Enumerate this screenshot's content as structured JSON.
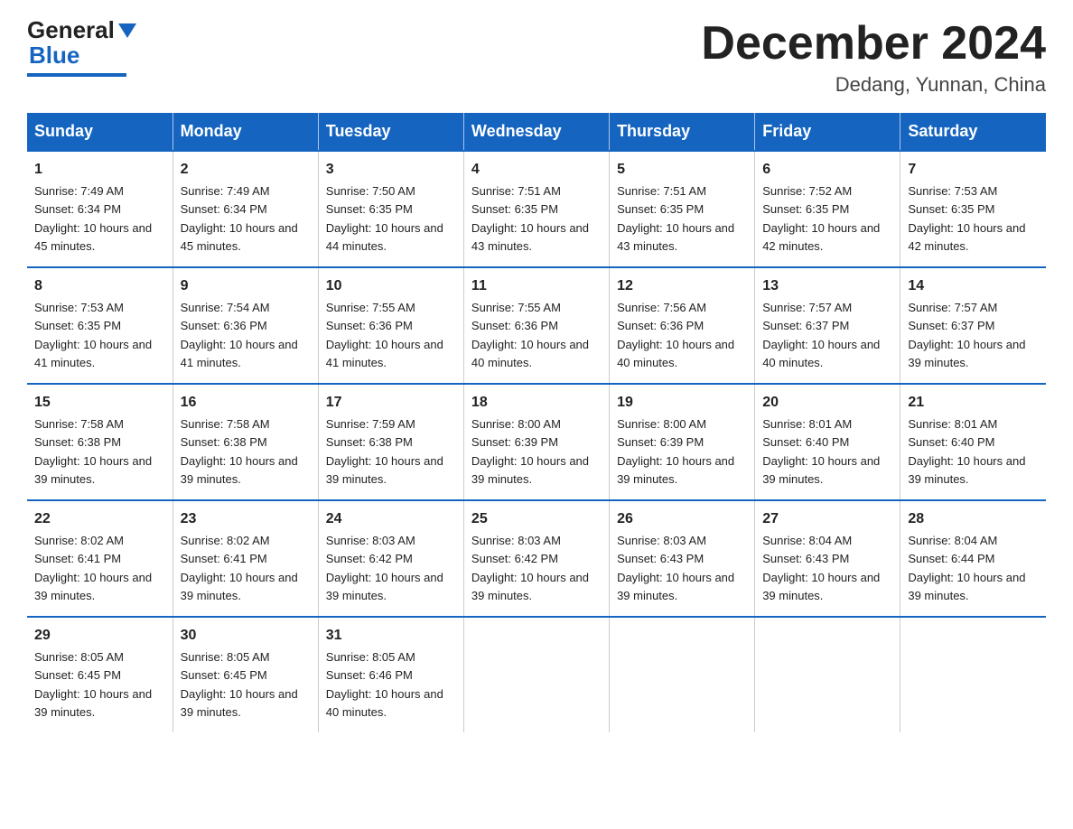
{
  "logo": {
    "general": "General",
    "triangle": "▶",
    "blue": "Blue"
  },
  "header": {
    "title": "December 2024",
    "subtitle": "Dedang, Yunnan, China"
  },
  "days_of_week": [
    "Sunday",
    "Monday",
    "Tuesday",
    "Wednesday",
    "Thursday",
    "Friday",
    "Saturday"
  ],
  "weeks": [
    [
      {
        "day": "1",
        "sunrise": "7:49 AM",
        "sunset": "6:34 PM",
        "daylight": "10 hours and 45 minutes."
      },
      {
        "day": "2",
        "sunrise": "7:49 AM",
        "sunset": "6:34 PM",
        "daylight": "10 hours and 45 minutes."
      },
      {
        "day": "3",
        "sunrise": "7:50 AM",
        "sunset": "6:35 PM",
        "daylight": "10 hours and 44 minutes."
      },
      {
        "day": "4",
        "sunrise": "7:51 AM",
        "sunset": "6:35 PM",
        "daylight": "10 hours and 43 minutes."
      },
      {
        "day": "5",
        "sunrise": "7:51 AM",
        "sunset": "6:35 PM",
        "daylight": "10 hours and 43 minutes."
      },
      {
        "day": "6",
        "sunrise": "7:52 AM",
        "sunset": "6:35 PM",
        "daylight": "10 hours and 42 minutes."
      },
      {
        "day": "7",
        "sunrise": "7:53 AM",
        "sunset": "6:35 PM",
        "daylight": "10 hours and 42 minutes."
      }
    ],
    [
      {
        "day": "8",
        "sunrise": "7:53 AM",
        "sunset": "6:35 PM",
        "daylight": "10 hours and 41 minutes."
      },
      {
        "day": "9",
        "sunrise": "7:54 AM",
        "sunset": "6:36 PM",
        "daylight": "10 hours and 41 minutes."
      },
      {
        "day": "10",
        "sunrise": "7:55 AM",
        "sunset": "6:36 PM",
        "daylight": "10 hours and 41 minutes."
      },
      {
        "day": "11",
        "sunrise": "7:55 AM",
        "sunset": "6:36 PM",
        "daylight": "10 hours and 40 minutes."
      },
      {
        "day": "12",
        "sunrise": "7:56 AM",
        "sunset": "6:36 PM",
        "daylight": "10 hours and 40 minutes."
      },
      {
        "day": "13",
        "sunrise": "7:57 AM",
        "sunset": "6:37 PM",
        "daylight": "10 hours and 40 minutes."
      },
      {
        "day": "14",
        "sunrise": "7:57 AM",
        "sunset": "6:37 PM",
        "daylight": "10 hours and 39 minutes."
      }
    ],
    [
      {
        "day": "15",
        "sunrise": "7:58 AM",
        "sunset": "6:38 PM",
        "daylight": "10 hours and 39 minutes."
      },
      {
        "day": "16",
        "sunrise": "7:58 AM",
        "sunset": "6:38 PM",
        "daylight": "10 hours and 39 minutes."
      },
      {
        "day": "17",
        "sunrise": "7:59 AM",
        "sunset": "6:38 PM",
        "daylight": "10 hours and 39 minutes."
      },
      {
        "day": "18",
        "sunrise": "8:00 AM",
        "sunset": "6:39 PM",
        "daylight": "10 hours and 39 minutes."
      },
      {
        "day": "19",
        "sunrise": "8:00 AM",
        "sunset": "6:39 PM",
        "daylight": "10 hours and 39 minutes."
      },
      {
        "day": "20",
        "sunrise": "8:01 AM",
        "sunset": "6:40 PM",
        "daylight": "10 hours and 39 minutes."
      },
      {
        "day": "21",
        "sunrise": "8:01 AM",
        "sunset": "6:40 PM",
        "daylight": "10 hours and 39 minutes."
      }
    ],
    [
      {
        "day": "22",
        "sunrise": "8:02 AM",
        "sunset": "6:41 PM",
        "daylight": "10 hours and 39 minutes."
      },
      {
        "day": "23",
        "sunrise": "8:02 AM",
        "sunset": "6:41 PM",
        "daylight": "10 hours and 39 minutes."
      },
      {
        "day": "24",
        "sunrise": "8:03 AM",
        "sunset": "6:42 PM",
        "daylight": "10 hours and 39 minutes."
      },
      {
        "day": "25",
        "sunrise": "8:03 AM",
        "sunset": "6:42 PM",
        "daylight": "10 hours and 39 minutes."
      },
      {
        "day": "26",
        "sunrise": "8:03 AM",
        "sunset": "6:43 PM",
        "daylight": "10 hours and 39 minutes."
      },
      {
        "day": "27",
        "sunrise": "8:04 AM",
        "sunset": "6:43 PM",
        "daylight": "10 hours and 39 minutes."
      },
      {
        "day": "28",
        "sunrise": "8:04 AM",
        "sunset": "6:44 PM",
        "daylight": "10 hours and 39 minutes."
      }
    ],
    [
      {
        "day": "29",
        "sunrise": "8:05 AM",
        "sunset": "6:45 PM",
        "daylight": "10 hours and 39 minutes."
      },
      {
        "day": "30",
        "sunrise": "8:05 AM",
        "sunset": "6:45 PM",
        "daylight": "10 hours and 39 minutes."
      },
      {
        "day": "31",
        "sunrise": "8:05 AM",
        "sunset": "6:46 PM",
        "daylight": "10 hours and 40 minutes."
      },
      null,
      null,
      null,
      null
    ]
  ]
}
